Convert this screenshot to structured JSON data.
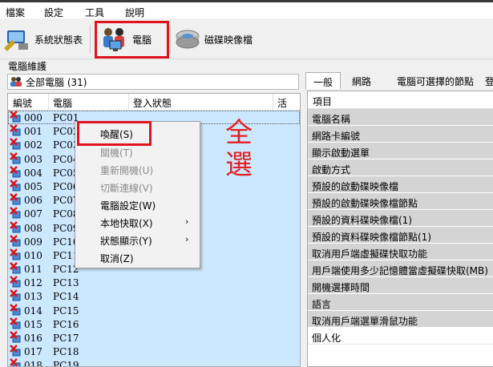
{
  "menu": [
    "檔案",
    "設定",
    "工具",
    "說明"
  ],
  "toolbar": {
    "system_status": "系統狀態表",
    "computer": "電腦",
    "disk_image": "磁碟映像檔"
  },
  "section_title": "電腦維護",
  "group_select": {
    "value": "全部電腦 (31)"
  },
  "list": {
    "headers": {
      "num": "編號",
      "computer": "電腦",
      "login_status": "登入狀態",
      "active": "活"
    },
    "rows": [
      {
        "num": "000",
        "pc": "PC01"
      },
      {
        "num": "001",
        "pc": "PC02"
      },
      {
        "num": "002",
        "pc": "PC03"
      },
      {
        "num": "003",
        "pc": "PC04"
      },
      {
        "num": "004",
        "pc": "PC05"
      },
      {
        "num": "005",
        "pc": "PC06"
      },
      {
        "num": "006",
        "pc": "PC07"
      },
      {
        "num": "007",
        "pc": "PC08"
      },
      {
        "num": "008",
        "pc": "PC09"
      },
      {
        "num": "009",
        "pc": "PC10"
      },
      {
        "num": "010",
        "pc": "PC11"
      },
      {
        "num": "011",
        "pc": "PC12"
      },
      {
        "num": "012",
        "pc": "PC13"
      },
      {
        "num": "013",
        "pc": "PC14"
      },
      {
        "num": "014",
        "pc": "PC15"
      },
      {
        "num": "015",
        "pc": "PC16"
      },
      {
        "num": "016",
        "pc": "PC17"
      },
      {
        "num": "017",
        "pc": "PC18"
      },
      {
        "num": "018",
        "pc": "PC19"
      }
    ]
  },
  "context_menu": {
    "wake": "喚醒(S)",
    "shutdown": "關機(T)",
    "restart": "重新開機(U)",
    "disconnect": "切斷連線(V)",
    "pc_settings": "電腦設定(W)",
    "local_snapshot": "本地快取(X)",
    "status_display": "狀態顯示(Y)",
    "cancel": "取消(Z)"
  },
  "annotation": "全選",
  "tabs": [
    "一般",
    "網路",
    "電腦可選擇的節點",
    "登"
  ],
  "properties": {
    "header": "項目",
    "items": [
      "電腦名稱",
      "網路卡編號",
      "顯示啟動選單",
      "啟動方式",
      "預設的啟動碟映像檔",
      "預設的啟動碟映像檔節點",
      "預設的資料碟映像檔(1)",
      "預設的資料碟映像檔節點(1)",
      "取消用戶端虛擬碟快取功能",
      "用戶端使用多少記憶體當虛擬碟快取(MB)",
      "開機選擇時間",
      "語言",
      "取消用戶端選單滑鼠功能",
      "個人化"
    ]
  },
  "colors": {
    "highlight": "#e0141e",
    "row_selected": "#cce8ff",
    "cell_gray": "#d4d4d4"
  }
}
